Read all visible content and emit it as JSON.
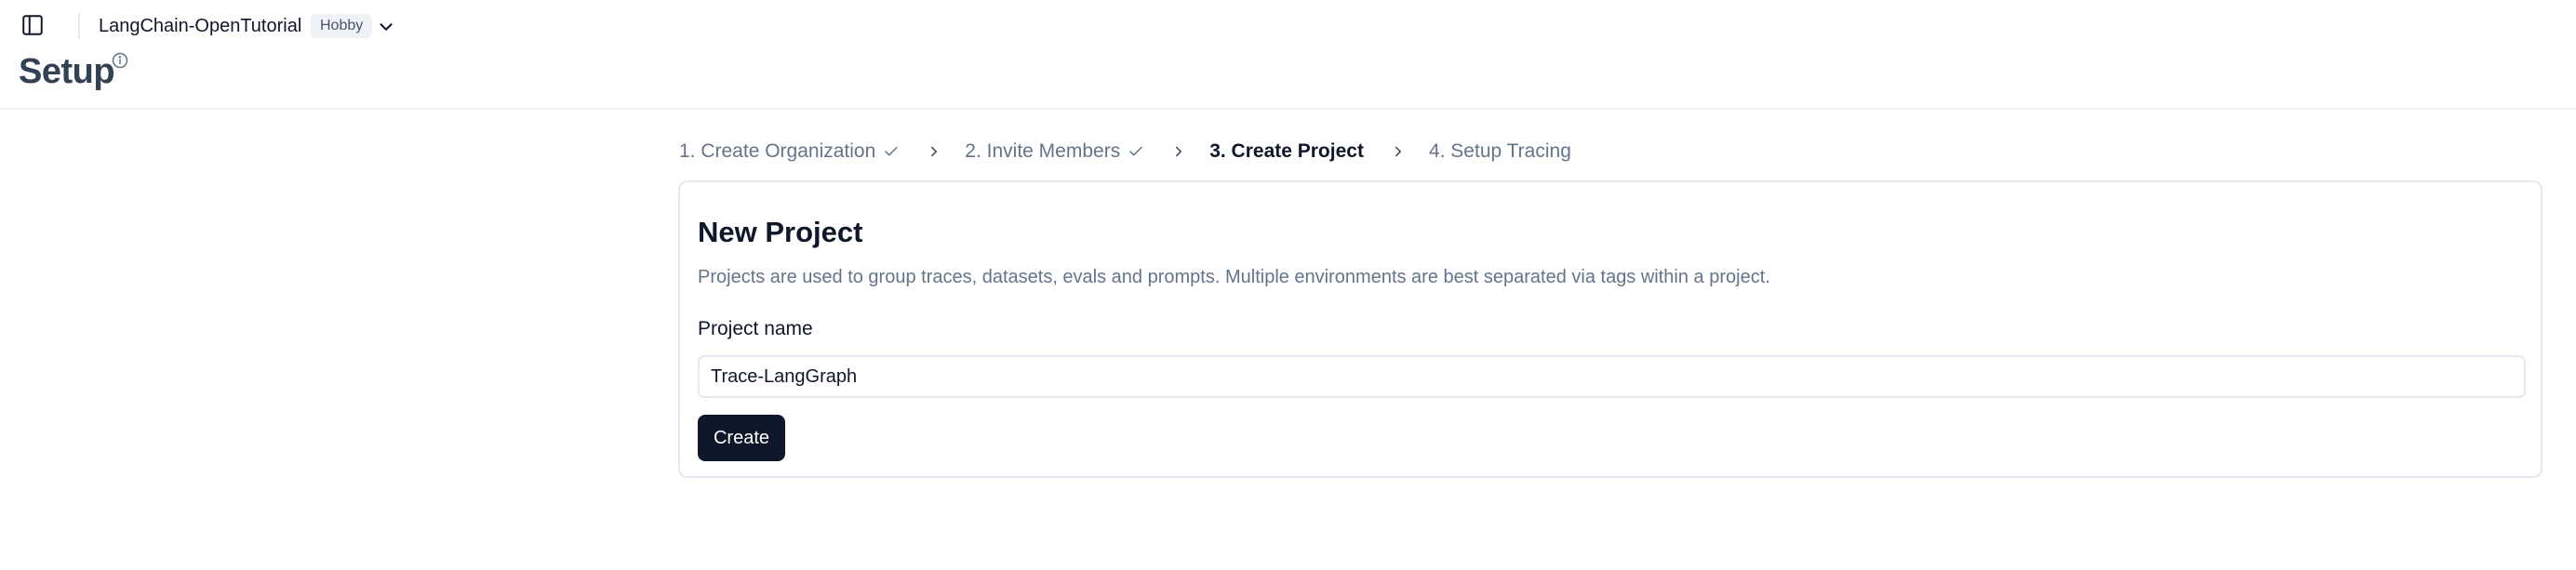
{
  "topbar": {
    "org_name": "LangChain-OpenTutorial",
    "plan_badge": "Hobby",
    "icons": [
      "sidebar-toggle-icon",
      "chevron-down-icon"
    ]
  },
  "page": {
    "title": "Setup",
    "title_icon": "info-icon"
  },
  "stepper": {
    "steps": [
      {
        "label": "1. Create Organization",
        "state": "completed"
      },
      {
        "label": "2. Invite Members",
        "state": "completed"
      },
      {
        "label": "3. Create Project",
        "state": "active"
      },
      {
        "label": "4. Setup Tracing",
        "state": "pending"
      }
    ],
    "separator_icon": "chevron-right-icon",
    "completed_icon": "check-icon"
  },
  "form": {
    "title": "New Project",
    "description": "Projects are used to group traces, datasets, evals and prompts. Multiple environments are best separated via tags within a project.",
    "project_name_label": "Project name",
    "project_name_value": "Trace-LangGraph",
    "submit_label": "Create"
  },
  "colors": {
    "primary_button": "#0f172a",
    "muted_text": "#64748b",
    "border": "#e5e9ef"
  }
}
